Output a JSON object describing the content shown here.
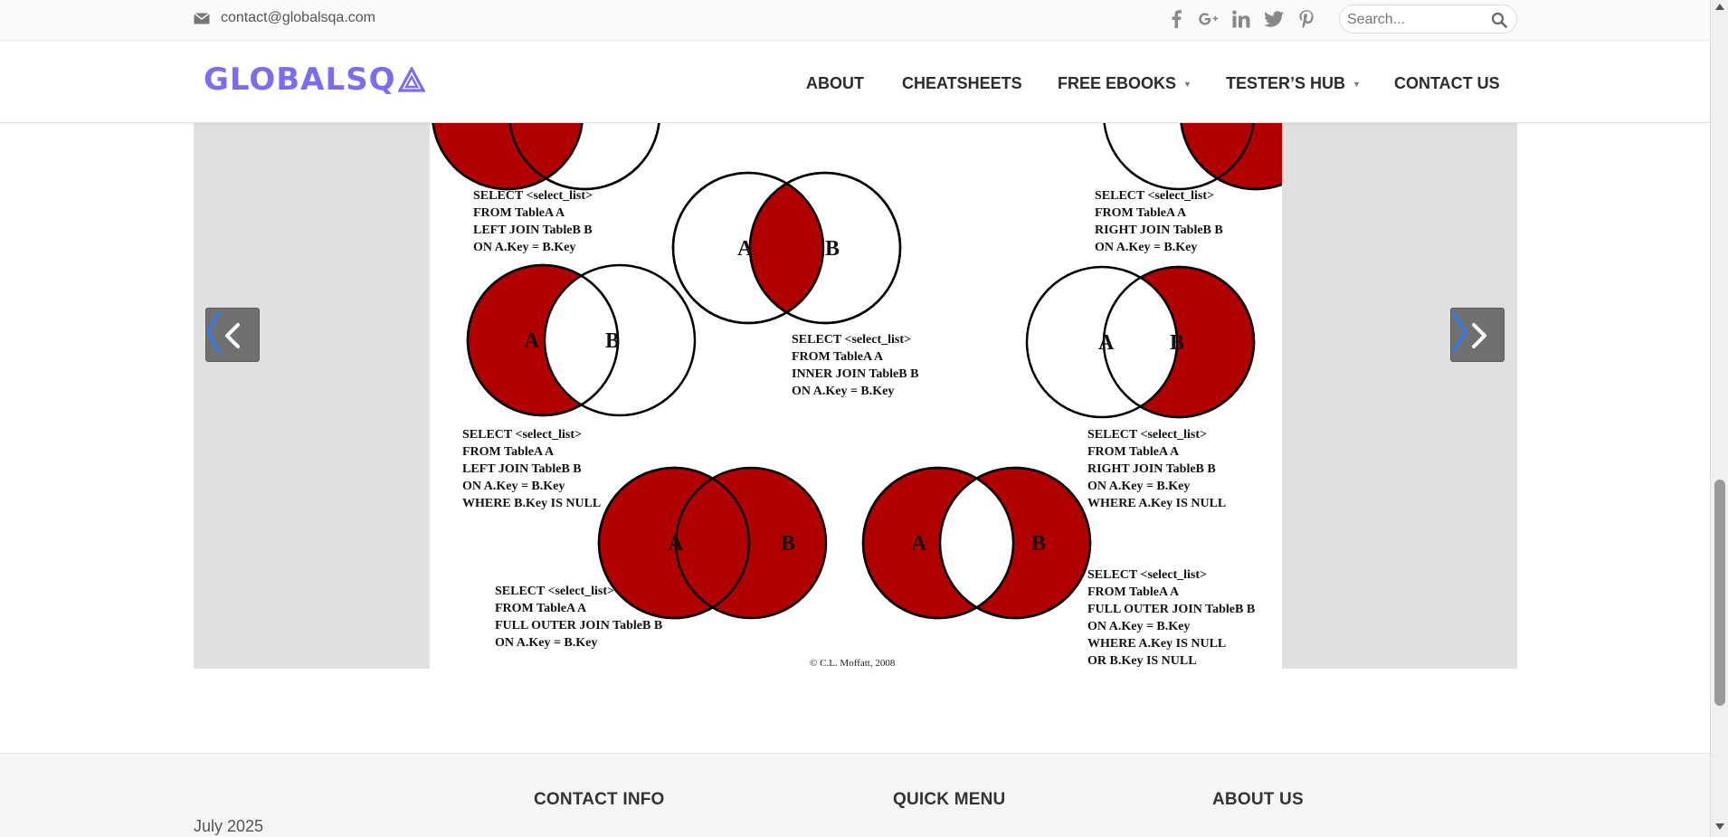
{
  "topbar": {
    "email": "contact@globalsqa.com",
    "social_icons": [
      "facebook-icon",
      "google-plus-icon",
      "linkedin-icon",
      "twitter-icon",
      "pinterest-icon"
    ],
    "search_placeholder": "Search..."
  },
  "header": {
    "logo_text": "GLOBALSQ",
    "logo_color": "#7b6cf0",
    "nav": {
      "about": "ABOUT",
      "cheatsheets": "CHEATSHEETS",
      "free_ebooks": "FREE EBOOKS",
      "testers_hub": "TESTER’S HUB",
      "contact_us": "CONTACT US"
    }
  },
  "slide": {
    "accent_color": "#b00000",
    "labels": {
      "a": "A",
      "b": "B"
    },
    "queries": {
      "left_join": [
        "SELECT <select_list>",
        "FROM TableA A",
        "LEFT JOIN TableB B",
        "ON A.Key = B.Key"
      ],
      "right_join": [
        "SELECT <select_list>",
        "FROM TableA A",
        "RIGHT JOIN TableB B",
        "ON A.Key = B.Key"
      ],
      "inner_join": [
        "SELECT <select_list>",
        "FROM TableA A",
        "INNER JOIN TableB B",
        "ON A.Key = B.Key"
      ],
      "left_excl": [
        "SELECT <select_list>",
        "FROM TableA A",
        "LEFT JOIN TableB B",
        "ON A.Key = B.Key",
        "WHERE B.Key IS NULL"
      ],
      "right_excl": [
        "SELECT <select_list>",
        "FROM TableA A",
        "RIGHT JOIN TableB B",
        "ON A.Key = B.Key",
        "WHERE A.Key IS NULL"
      ],
      "full_outer": [
        "SELECT <select_list>",
        "FROM TableA A",
        "FULL OUTER JOIN TableB B",
        "ON A.Key = B.Key"
      ],
      "full_excl": [
        "SELECT <select_list>",
        "FROM TableA A",
        "FULL OUTER JOIN TableB B",
        "ON A.Key = B.Key",
        "WHERE A.Key IS NULL",
        "OR B.Key IS NULL"
      ]
    },
    "copyright": "© C.L. Moffatt, 2008"
  },
  "footer": {
    "contact_info": "CONTACT INFO",
    "quick_menu": "QUICK MENU",
    "about_us": "ABOUT US",
    "date": "July 2025"
  }
}
